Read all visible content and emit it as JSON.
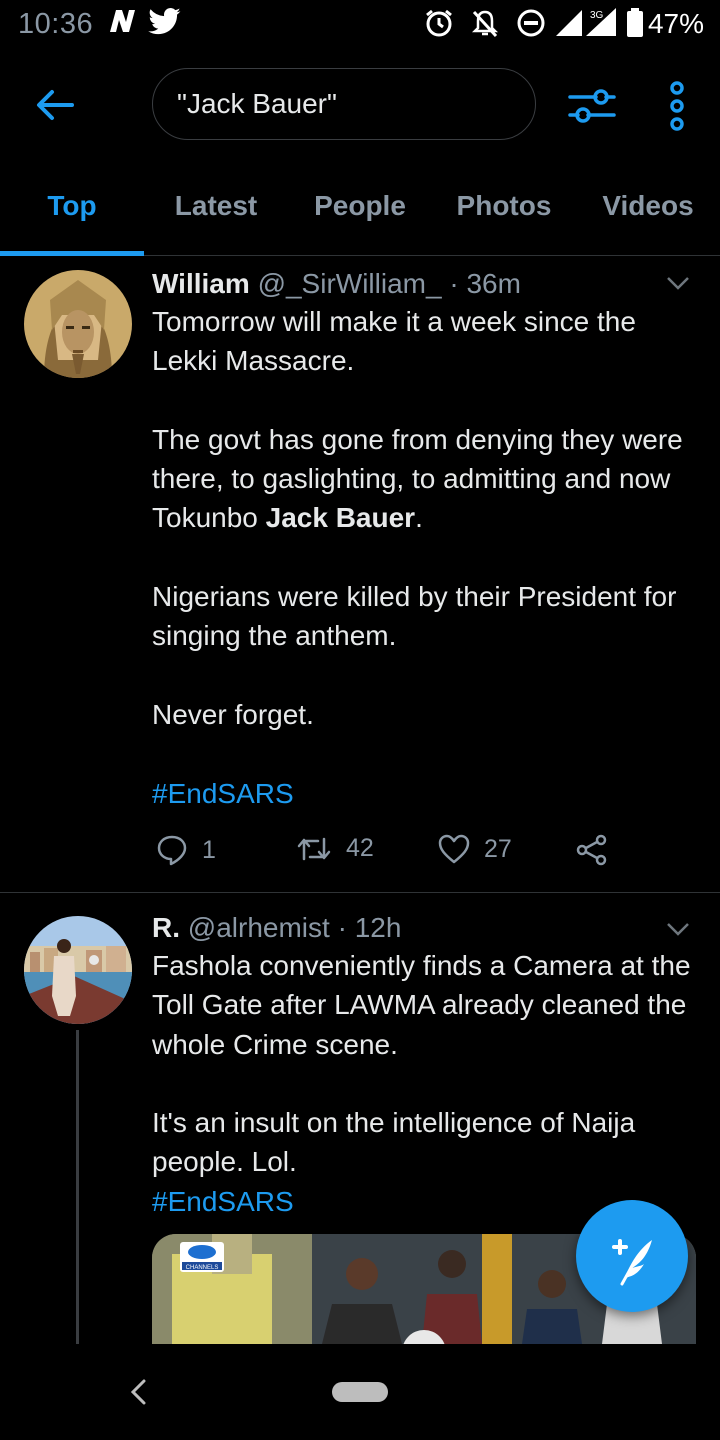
{
  "status_bar": {
    "time": "10:36",
    "battery": "47%",
    "network": "3G"
  },
  "search": {
    "query": "\"Jack Bauer\""
  },
  "tabs": [
    {
      "label": "Top",
      "active": true
    },
    {
      "label": "Latest",
      "active": false
    },
    {
      "label": "People",
      "active": false
    },
    {
      "label": "Photos",
      "active": false
    },
    {
      "label": "Videos",
      "active": false
    }
  ],
  "tweets": [
    {
      "name": "William",
      "handle": "@_SirWilliam_",
      "time": "36m",
      "text": {
        "p1": "Tomorrow will make it a week since the Lekki Massacre.",
        "p2_pre": "The govt has gone from denying they were there, to gaslighting, to admitting and now Tokunbo ",
        "p2_bold": "Jack Bauer",
        "p2_post": ".",
        "p3": "Nigerians were killed by their President for singing the anthem.",
        "p4": "Never forget.",
        "hashtag": "#EndSARS"
      },
      "replies": "1",
      "retweets": "42",
      "likes": "27"
    },
    {
      "name": "R.",
      "handle": "@alrhemist",
      "time": "12h",
      "text": {
        "p1": "Fashola conveniently finds a Camera at the Toll Gate after LAWMA already cleaned the whole Crime scene.",
        "p2": "It's an insult on the intelligence of Naija people. Lol.",
        "hashtag": "#EndSARS"
      },
      "media_label": "CHANNELS"
    }
  ],
  "colors": {
    "accent": "#1d9bf0",
    "background": "#000000",
    "secondary_text": "#8b98a5"
  }
}
